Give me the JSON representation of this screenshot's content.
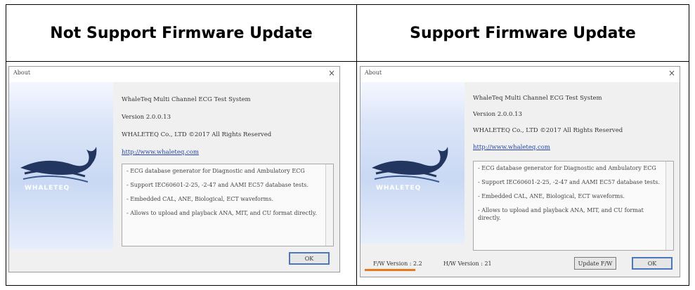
{
  "table": {
    "headers": [
      "Not Support Firmware Update",
      "Support Firmware Update"
    ]
  },
  "dialogs": [
    {
      "title": "About",
      "close_glyph": "×",
      "logo_text": "WHALETEQ",
      "product_line": "WhaleTeq Multi Channel ECG Test System",
      "version_line": "Version 2.0.0.13",
      "copyright_line": "WHALETEQ Co., LTD ©2017 All Rights Reserved",
      "link": "http://www.whaleteq.com",
      "description": [
        "- ECG database generator for Diagnostic and Ambulatory ECG",
        "- Support IEC60601-2-25, -2-47 and AAMI EC57 database tests.",
        "- Embedded CAL, ANE, Biological, ECT waveforms.",
        "- Allows to upload and playback ANA, MIT, and CU format directly."
      ],
      "ok_label": "OK"
    },
    {
      "title": "About",
      "close_glyph": "×",
      "logo_text": "WHALETEQ",
      "product_line": "WhaleTeq Multi Channel ECG Test System",
      "version_line": "Version 2.0.0.13",
      "copyright_line": "WHALETEQ Co., LTD ©2017 All Rights Reserved",
      "link": "http://www.whaleteq.com",
      "description": [
        "- ECG database generator for Diagnostic and Ambulatory ECG",
        "- Support IEC60601-2-25, -2-47 and AAMI EC57 database tests.",
        "- Embedded CAL, ANE, Biological, ECT waveforms.",
        "- Allows to upload and playback ANA, MIT, and CU format directly."
      ],
      "fw_version": "F/W Version : 2.2",
      "hw_version": "H/W Version : 21",
      "update_label": "Update F/W",
      "ok_label": "OK",
      "highlight_color": "#e8781e"
    }
  ]
}
